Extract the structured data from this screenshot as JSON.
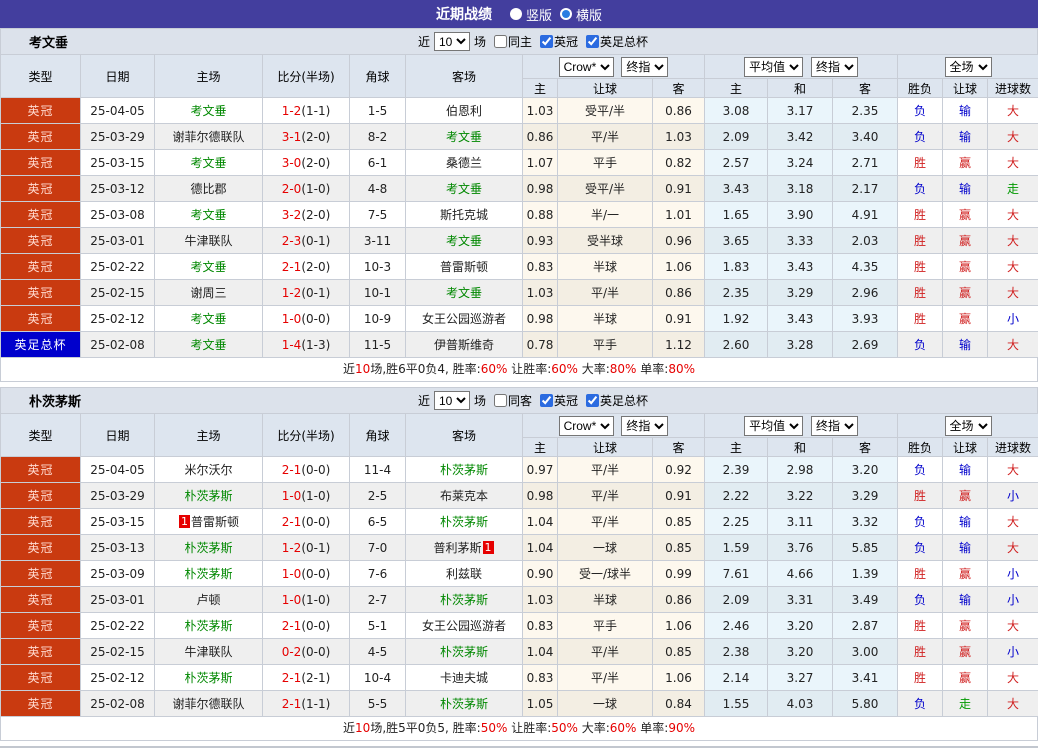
{
  "title_bar": {
    "title": "近期战绩",
    "options": [
      {
        "label": "竖版",
        "selected": false
      },
      {
        "label": "横版",
        "selected": true
      }
    ]
  },
  "colors": {
    "titlebar_bg": "#433e9e",
    "league_badge_bg": "#c93a10",
    "cup_badge_bg": "#0000cc",
    "focus_team": "#008800",
    "score_red": "#e60000",
    "win_red": "#d02020",
    "lose_blue": "#0000cc",
    "push_green": "#009900",
    "header_bg": "#dde5ef"
  },
  "filter_labels": {
    "near": "近",
    "count": "10",
    "games": "场"
  },
  "columns": {
    "type": "类型",
    "date": "日期",
    "home": "主场",
    "score": "比分(半场)",
    "corner": "角球",
    "away": "客场",
    "odds_source": "Crow*",
    "odds_final": "终指",
    "avg_source": "平均值",
    "avg_final": "终指",
    "scope": "全场",
    "odds_home": "主",
    "odds_handicap": "让球",
    "odds_away": "客",
    "avg_home": "主",
    "avg_draw": "和",
    "avg_away": "客",
    "result_wl": "胜负",
    "result_handicap": "让球",
    "result_goals": "进球数"
  },
  "sections": [
    {
      "team": "考文垂",
      "filters": [
        {
          "label": "同主",
          "checked": false
        },
        {
          "label": "英冠",
          "checked": true
        },
        {
          "label": "英足总杯",
          "checked": true
        }
      ],
      "rows": [
        {
          "type": "英冠",
          "type_class": "league",
          "date": "25-04-05",
          "home": "考文垂",
          "home_focus": true,
          "score": "1-2",
          "half": "(1-1)",
          "corner": "1-5",
          "away": "伯恩利",
          "away_focus": false,
          "odds": [
            "1.03",
            "受平/半",
            "0.86"
          ],
          "avg": [
            "3.08",
            "3.17",
            "2.35"
          ],
          "results": [
            {
              "t": "负",
              "c": "blue"
            },
            {
              "t": "输",
              "c": "blue"
            },
            {
              "t": "大",
              "c": "red"
            }
          ]
        },
        {
          "type": "英冠",
          "type_class": "league",
          "date": "25-03-29",
          "home": "谢菲尔德联队",
          "home_focus": false,
          "score": "3-1",
          "half": "(2-0)",
          "corner": "8-2",
          "away": "考文垂",
          "away_focus": true,
          "odds": [
            "0.86",
            "平/半",
            "1.03"
          ],
          "avg": [
            "2.09",
            "3.42",
            "3.40"
          ],
          "results": [
            {
              "t": "负",
              "c": "blue"
            },
            {
              "t": "输",
              "c": "blue"
            },
            {
              "t": "大",
              "c": "red"
            }
          ]
        },
        {
          "type": "英冠",
          "type_class": "league",
          "date": "25-03-15",
          "home": "考文垂",
          "home_focus": true,
          "score": "3-0",
          "half": "(2-0)",
          "corner": "6-1",
          "away": "桑德兰",
          "away_focus": false,
          "odds": [
            "1.07",
            "平手",
            "0.82"
          ],
          "avg": [
            "2.57",
            "3.24",
            "2.71"
          ],
          "results": [
            {
              "t": "胜",
              "c": "red"
            },
            {
              "t": "赢",
              "c": "red"
            },
            {
              "t": "大",
              "c": "red"
            }
          ]
        },
        {
          "type": "英冠",
          "type_class": "league",
          "date": "25-03-12",
          "home": "德比郡",
          "home_focus": false,
          "score": "2-0",
          "half": "(1-0)",
          "corner": "4-8",
          "away": "考文垂",
          "away_focus": true,
          "odds": [
            "0.98",
            "受平/半",
            "0.91"
          ],
          "avg": [
            "3.43",
            "3.18",
            "2.17"
          ],
          "results": [
            {
              "t": "负",
              "c": "blue"
            },
            {
              "t": "输",
              "c": "blue"
            },
            {
              "t": "走",
              "c": "green"
            }
          ]
        },
        {
          "type": "英冠",
          "type_class": "league",
          "date": "25-03-08",
          "home": "考文垂",
          "home_focus": true,
          "score": "3-2",
          "half": "(2-0)",
          "corner": "7-5",
          "away": "斯托克城",
          "away_focus": false,
          "odds": [
            "0.88",
            "半/一",
            "1.01"
          ],
          "avg": [
            "1.65",
            "3.90",
            "4.91"
          ],
          "results": [
            {
              "t": "胜",
              "c": "red"
            },
            {
              "t": "赢",
              "c": "red"
            },
            {
              "t": "大",
              "c": "red"
            }
          ]
        },
        {
          "type": "英冠",
          "type_class": "league",
          "date": "25-03-01",
          "home": "牛津联队",
          "home_focus": false,
          "score": "2-3",
          "half": "(0-1)",
          "corner": "3-11",
          "away": "考文垂",
          "away_focus": true,
          "odds": [
            "0.93",
            "受半球",
            "0.96"
          ],
          "avg": [
            "3.65",
            "3.33",
            "2.03"
          ],
          "results": [
            {
              "t": "胜",
              "c": "red"
            },
            {
              "t": "赢",
              "c": "red"
            },
            {
              "t": "大",
              "c": "red"
            }
          ]
        },
        {
          "type": "英冠",
          "type_class": "league",
          "date": "25-02-22",
          "home": "考文垂",
          "home_focus": true,
          "score": "2-1",
          "half": "(2-0)",
          "corner": "10-3",
          "away": "普雷斯顿",
          "away_focus": false,
          "odds": [
            "0.83",
            "半球",
            "1.06"
          ],
          "avg": [
            "1.83",
            "3.43",
            "4.35"
          ],
          "results": [
            {
              "t": "胜",
              "c": "red"
            },
            {
              "t": "赢",
              "c": "red"
            },
            {
              "t": "大",
              "c": "red"
            }
          ]
        },
        {
          "type": "英冠",
          "type_class": "league",
          "date": "25-02-15",
          "home": "谢周三",
          "home_focus": false,
          "score": "1-2",
          "half": "(0-1)",
          "corner": "10-1",
          "away": "考文垂",
          "away_focus": true,
          "odds": [
            "1.03",
            "平/半",
            "0.86"
          ],
          "avg": [
            "2.35",
            "3.29",
            "2.96"
          ],
          "results": [
            {
              "t": "胜",
              "c": "red"
            },
            {
              "t": "赢",
              "c": "red"
            },
            {
              "t": "大",
              "c": "red"
            }
          ]
        },
        {
          "type": "英冠",
          "type_class": "league",
          "date": "25-02-12",
          "home": "考文垂",
          "home_focus": true,
          "score": "1-0",
          "half": "(0-0)",
          "corner": "10-9",
          "away": "女王公园巡游者",
          "away_focus": false,
          "odds": [
            "0.98",
            "半球",
            "0.91"
          ],
          "avg": [
            "1.92",
            "3.43",
            "3.93"
          ],
          "results": [
            {
              "t": "胜",
              "c": "red"
            },
            {
              "t": "赢",
              "c": "red"
            },
            {
              "t": "小",
              "c": "blue"
            }
          ]
        },
        {
          "type": "英足总杯",
          "type_class": "cup",
          "date": "25-02-08",
          "home": "考文垂",
          "home_focus": true,
          "score": "1-4",
          "half": "(1-3)",
          "corner": "11-5",
          "away": "伊普斯维奇",
          "away_focus": false,
          "odds": [
            "0.78",
            "平手",
            "1.12"
          ],
          "avg": [
            "2.60",
            "3.28",
            "2.69"
          ],
          "results": [
            {
              "t": "负",
              "c": "blue"
            },
            {
              "t": "输",
              "c": "blue"
            },
            {
              "t": "大",
              "c": "red"
            }
          ]
        }
      ],
      "summary": [
        [
          "近",
          "k"
        ],
        [
          "10",
          "r"
        ],
        [
          "场,胜6平0负4, 胜率:",
          "k"
        ],
        [
          "60%",
          "r"
        ],
        [
          " 让胜率:",
          "k"
        ],
        [
          "60%",
          "r"
        ],
        [
          " 大率:",
          "k"
        ],
        [
          "80%",
          "r"
        ],
        [
          " 单率:",
          "k"
        ],
        [
          "80%",
          "r"
        ]
      ]
    },
    {
      "team": "朴茨茅斯",
      "filters": [
        {
          "label": "同客",
          "checked": false
        },
        {
          "label": "英冠",
          "checked": true
        },
        {
          "label": "英足总杯",
          "checked": true
        }
      ],
      "rows": [
        {
          "type": "英冠",
          "type_class": "league",
          "date": "25-04-05",
          "home": "米尔沃尔",
          "home_focus": false,
          "score": "2-1",
          "half": "(0-0)",
          "corner": "11-4",
          "away": "朴茨茅斯",
          "away_focus": true,
          "odds": [
            "0.97",
            "平/半",
            "0.92"
          ],
          "avg": [
            "2.39",
            "2.98",
            "3.20"
          ],
          "results": [
            {
              "t": "负",
              "c": "blue"
            },
            {
              "t": "输",
              "c": "blue"
            },
            {
              "t": "大",
              "c": "red"
            }
          ]
        },
        {
          "type": "英冠",
          "type_class": "league",
          "date": "25-03-29",
          "home": "朴茨茅斯",
          "home_focus": true,
          "score": "1-0",
          "half": "(1-0)",
          "corner": "2-5",
          "away": "布莱克本",
          "away_focus": false,
          "odds": [
            "0.98",
            "平/半",
            "0.91"
          ],
          "avg": [
            "2.22",
            "3.22",
            "3.29"
          ],
          "results": [
            {
              "t": "胜",
              "c": "red"
            },
            {
              "t": "赢",
              "c": "red"
            },
            {
              "t": "小",
              "c": "blue"
            }
          ]
        },
        {
          "type": "英冠",
          "type_class": "league",
          "date": "25-03-15",
          "home": "普雷斯顿",
          "home_focus": false,
          "home_badge": "1",
          "score": "2-1",
          "half": "(0-0)",
          "corner": "6-5",
          "away": "朴茨茅斯",
          "away_focus": true,
          "odds": [
            "1.04",
            "平/半",
            "0.85"
          ],
          "avg": [
            "2.25",
            "3.11",
            "3.32"
          ],
          "results": [
            {
              "t": "负",
              "c": "blue"
            },
            {
              "t": "输",
              "c": "blue"
            },
            {
              "t": "大",
              "c": "red"
            }
          ]
        },
        {
          "type": "英冠",
          "type_class": "league",
          "date": "25-03-13",
          "home": "朴茨茅斯",
          "home_focus": true,
          "score": "1-2",
          "half": "(0-1)",
          "corner": "7-0",
          "away": "普利茅斯",
          "away_focus": false,
          "away_badge": "1",
          "odds": [
            "1.04",
            "一球",
            "0.85"
          ],
          "avg": [
            "1.59",
            "3.76",
            "5.85"
          ],
          "results": [
            {
              "t": "负",
              "c": "blue"
            },
            {
              "t": "输",
              "c": "blue"
            },
            {
              "t": "大",
              "c": "red"
            }
          ]
        },
        {
          "type": "英冠",
          "type_class": "league",
          "date": "25-03-09",
          "home": "朴茨茅斯",
          "home_focus": true,
          "score": "1-0",
          "half": "(0-0)",
          "corner": "7-6",
          "away": "利兹联",
          "away_focus": false,
          "odds": [
            "0.90",
            "受一/球半",
            "0.99"
          ],
          "avg": [
            "7.61",
            "4.66",
            "1.39"
          ],
          "results": [
            {
              "t": "胜",
              "c": "red"
            },
            {
              "t": "赢",
              "c": "red"
            },
            {
              "t": "小",
              "c": "blue"
            }
          ]
        },
        {
          "type": "英冠",
          "type_class": "league",
          "date": "25-03-01",
          "home": "卢顿",
          "home_focus": false,
          "score": "1-0",
          "half": "(1-0)",
          "corner": "2-7",
          "away": "朴茨茅斯",
          "away_focus": true,
          "odds": [
            "1.03",
            "半球",
            "0.86"
          ],
          "avg": [
            "2.09",
            "3.31",
            "3.49"
          ],
          "results": [
            {
              "t": "负",
              "c": "blue"
            },
            {
              "t": "输",
              "c": "blue"
            },
            {
              "t": "小",
              "c": "blue"
            }
          ]
        },
        {
          "type": "英冠",
          "type_class": "league",
          "date": "25-02-22",
          "home": "朴茨茅斯",
          "home_focus": true,
          "score": "2-1",
          "half": "(0-0)",
          "corner": "5-1",
          "away": "女王公园巡游者",
          "away_focus": false,
          "odds": [
            "0.83",
            "平手",
            "1.06"
          ],
          "avg": [
            "2.46",
            "3.20",
            "2.87"
          ],
          "results": [
            {
              "t": "胜",
              "c": "red"
            },
            {
              "t": "赢",
              "c": "red"
            },
            {
              "t": "大",
              "c": "red"
            }
          ]
        },
        {
          "type": "英冠",
          "type_class": "league",
          "date": "25-02-15",
          "home": "牛津联队",
          "home_focus": false,
          "score": "0-2",
          "half": "(0-0)",
          "corner": "4-5",
          "away": "朴茨茅斯",
          "away_focus": true,
          "odds": [
            "1.04",
            "平/半",
            "0.85"
          ],
          "avg": [
            "2.38",
            "3.20",
            "3.00"
          ],
          "results": [
            {
              "t": "胜",
              "c": "red"
            },
            {
              "t": "赢",
              "c": "red"
            },
            {
              "t": "小",
              "c": "blue"
            }
          ]
        },
        {
          "type": "英冠",
          "type_class": "league",
          "date": "25-02-12",
          "home": "朴茨茅斯",
          "home_focus": true,
          "score": "2-1",
          "half": "(2-1)",
          "corner": "10-4",
          "away": "卡迪夫城",
          "away_focus": false,
          "odds": [
            "0.83",
            "平/半",
            "1.06"
          ],
          "avg": [
            "2.14",
            "3.27",
            "3.41"
          ],
          "results": [
            {
              "t": "胜",
              "c": "red"
            },
            {
              "t": "赢",
              "c": "red"
            },
            {
              "t": "大",
              "c": "red"
            }
          ]
        },
        {
          "type": "英冠",
          "type_class": "league",
          "date": "25-02-08",
          "home": "谢菲尔德联队",
          "home_focus": false,
          "score": "2-1",
          "half": "(1-1)",
          "corner": "5-5",
          "away": "朴茨茅斯",
          "away_focus": true,
          "odds": [
            "1.05",
            "一球",
            "0.84"
          ],
          "avg": [
            "1.55",
            "4.03",
            "5.80"
          ],
          "results": [
            {
              "t": "负",
              "c": "blue"
            },
            {
              "t": "走",
              "c": "green"
            },
            {
              "t": "大",
              "c": "red"
            }
          ]
        }
      ],
      "summary": [
        [
          "近",
          "k"
        ],
        [
          "10",
          "r"
        ],
        [
          "场,胜5平0负5, 胜率:",
          "k"
        ],
        [
          "50%",
          "r"
        ],
        [
          " 让胜率:",
          "k"
        ],
        [
          "50%",
          "r"
        ],
        [
          " 大率:",
          "k"
        ],
        [
          "60%",
          "r"
        ],
        [
          " 单率:",
          "k"
        ],
        [
          "90%",
          "r"
        ]
      ]
    }
  ]
}
